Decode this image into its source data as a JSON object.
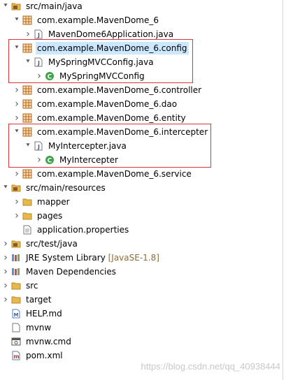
{
  "tree": [
    {
      "label": "src/main/java",
      "icon": "source-folder-icon",
      "twisty": "expanded",
      "level": 0
    },
    {
      "label": "com.example.MavenDome_6",
      "icon": "package-icon",
      "twisty": "expanded",
      "level": 1
    },
    {
      "label": "MavenDome6Application.java",
      "icon": "java-file-icon",
      "twisty": "collapsed",
      "level": 2
    },
    {
      "label": "com.example.MavenDome_6.config",
      "icon": "package-icon",
      "twisty": "expanded",
      "level": 1,
      "selected": true
    },
    {
      "label": "MySpringMVCConfig.java",
      "icon": "java-file-icon",
      "twisty": "expanded",
      "level": 2
    },
    {
      "label": "MySpringMVCConfig",
      "icon": "class-icon",
      "twisty": "collapsed",
      "level": 3
    },
    {
      "label": "com.example.MavenDome_6.controller",
      "icon": "package-icon",
      "twisty": "collapsed",
      "level": 1
    },
    {
      "label": "com.example.MavenDome_6.dao",
      "icon": "package-icon",
      "twisty": "collapsed",
      "level": 1
    },
    {
      "label": "com.example.MavenDome_6.entity",
      "icon": "package-icon",
      "twisty": "collapsed",
      "level": 1
    },
    {
      "label": "com.example.MavenDome_6.intercepter",
      "icon": "package-icon",
      "twisty": "expanded",
      "level": 1
    },
    {
      "label": "MyIntercepter.java",
      "icon": "java-file-icon",
      "twisty": "expanded",
      "level": 2
    },
    {
      "label": "MyIntercepter",
      "icon": "class-icon",
      "twisty": "collapsed",
      "level": 3
    },
    {
      "label": "com.example.MavenDome_6.service",
      "icon": "package-icon",
      "twisty": "collapsed",
      "level": 1
    },
    {
      "label": "src/main/resources",
      "icon": "source-folder-icon",
      "twisty": "expanded",
      "level": 0
    },
    {
      "label": "mapper",
      "icon": "folder-icon",
      "twisty": "collapsed",
      "level": 1
    },
    {
      "label": "pages",
      "icon": "folder-icon",
      "twisty": "collapsed",
      "level": 1
    },
    {
      "label": "application.properties",
      "icon": "properties-file-icon",
      "twisty": "none",
      "level": 1
    },
    {
      "label": "src/test/java",
      "icon": "source-folder-icon",
      "twisty": "collapsed",
      "level": 0
    },
    {
      "label": "JRE System Library",
      "suffix": "[JavaSE-1.8]",
      "icon": "library-icon",
      "twisty": "collapsed",
      "level": 0
    },
    {
      "label": "Maven Dependencies",
      "icon": "library-icon",
      "twisty": "collapsed",
      "level": 0
    },
    {
      "label": "src",
      "icon": "folder-icon",
      "twisty": "collapsed",
      "level": 0
    },
    {
      "label": "target",
      "icon": "folder-icon",
      "twisty": "collapsed",
      "level": 0
    },
    {
      "label": "HELP.md",
      "icon": "markdown-file-icon",
      "twisty": "none",
      "level": 0
    },
    {
      "label": "mvnw",
      "icon": "text-file-icon",
      "twisty": "none",
      "level": 0
    },
    {
      "label": "mvnw.cmd",
      "icon": "cmd-file-icon",
      "twisty": "none",
      "level": 0
    },
    {
      "label": "pom.xml",
      "icon": "xml-file-icon",
      "twisty": "none",
      "level": 0
    }
  ],
  "watermark": "https://blog.csdn.net/qq_40938444",
  "colors": {
    "selection": "#cce8ff",
    "highlight_box": "#d9363e",
    "package": "#b5661e",
    "folder": "#e8b84a",
    "class": "#3fa34d",
    "library_suffix": "#8a6d3b"
  }
}
